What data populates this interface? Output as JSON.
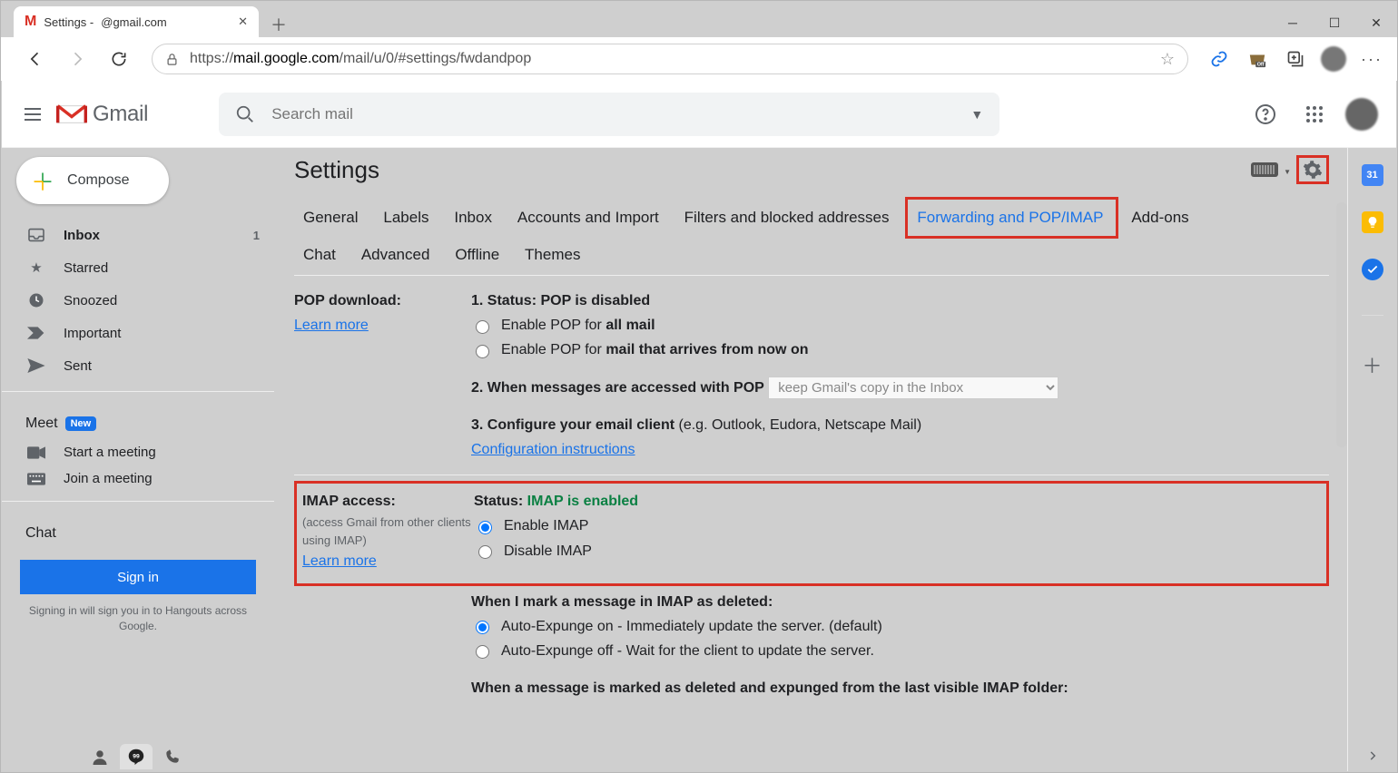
{
  "browser": {
    "tab_title_prefix": "Settings - ",
    "tab_title_suffix": "@gmail.com",
    "url_scheme": "https://",
    "url_host": "mail.google.com",
    "url_path": "/mail/u/0/#settings/fwdandpop"
  },
  "gmail_header": {
    "product": "Gmail",
    "search_placeholder": "Search mail"
  },
  "sidebar": {
    "compose": "Compose",
    "nav": [
      {
        "icon": "inbox",
        "label": "Inbox",
        "count": "1",
        "bold": true
      },
      {
        "icon": "star",
        "label": "Starred"
      },
      {
        "icon": "clock",
        "label": "Snoozed"
      },
      {
        "icon": "important",
        "label": "Important"
      },
      {
        "icon": "send",
        "label": "Sent"
      }
    ],
    "meet_label": "Meet",
    "meet_badge": "New",
    "meet_items": [
      {
        "icon": "camera",
        "label": "Start a meeting"
      },
      {
        "icon": "keyboard",
        "label": "Join a meeting"
      }
    ],
    "chat_label": "Chat",
    "signin_button": "Sign in",
    "signin_note": "Signing in will sign you in to Hangouts across Google."
  },
  "settings": {
    "title": "Settings",
    "tabs": [
      "General",
      "Labels",
      "Inbox",
      "Accounts and Import",
      "Filters and blocked addresses",
      "Forwarding and POP/IMAP",
      "Add-ons",
      "Chat",
      "Advanced",
      "Offline",
      "Themes"
    ],
    "active_tab_index": 5,
    "pop": {
      "heading": "POP download:",
      "learn_more": "Learn more",
      "status_prefix": "1. Status: ",
      "status_value": "POP is disabled",
      "opt1_prefix": "Enable POP for ",
      "opt1_bold": "all mail",
      "opt2_prefix": "Enable POP for ",
      "opt2_bold": "mail that arrives from now on",
      "step2": "2. When messages are accessed with POP",
      "step2_select": "keep Gmail's copy in the Inbox",
      "step3_a": "3. Configure your email client ",
      "step3_b": "(e.g. Outlook, Eudora, Netscape Mail)",
      "step3_link": "Configuration instructions"
    },
    "imap": {
      "heading": "IMAP access:",
      "sub": "(access Gmail from other clients using IMAP)",
      "learn_more": "Learn more",
      "status_prefix": "Status: ",
      "status_value": "IMAP is enabled",
      "opt_enable": "Enable IMAP",
      "opt_disable": "Disable IMAP",
      "deleted_heading": "When I mark a message in IMAP as deleted:",
      "deleted_opt1": "Auto-Expunge on - Immediately update the server. (default)",
      "deleted_opt2": "Auto-Expunge off - Wait for the client to update the server.",
      "expunged_heading": "When a message is marked as deleted and expunged from the last visible IMAP folder:"
    }
  }
}
